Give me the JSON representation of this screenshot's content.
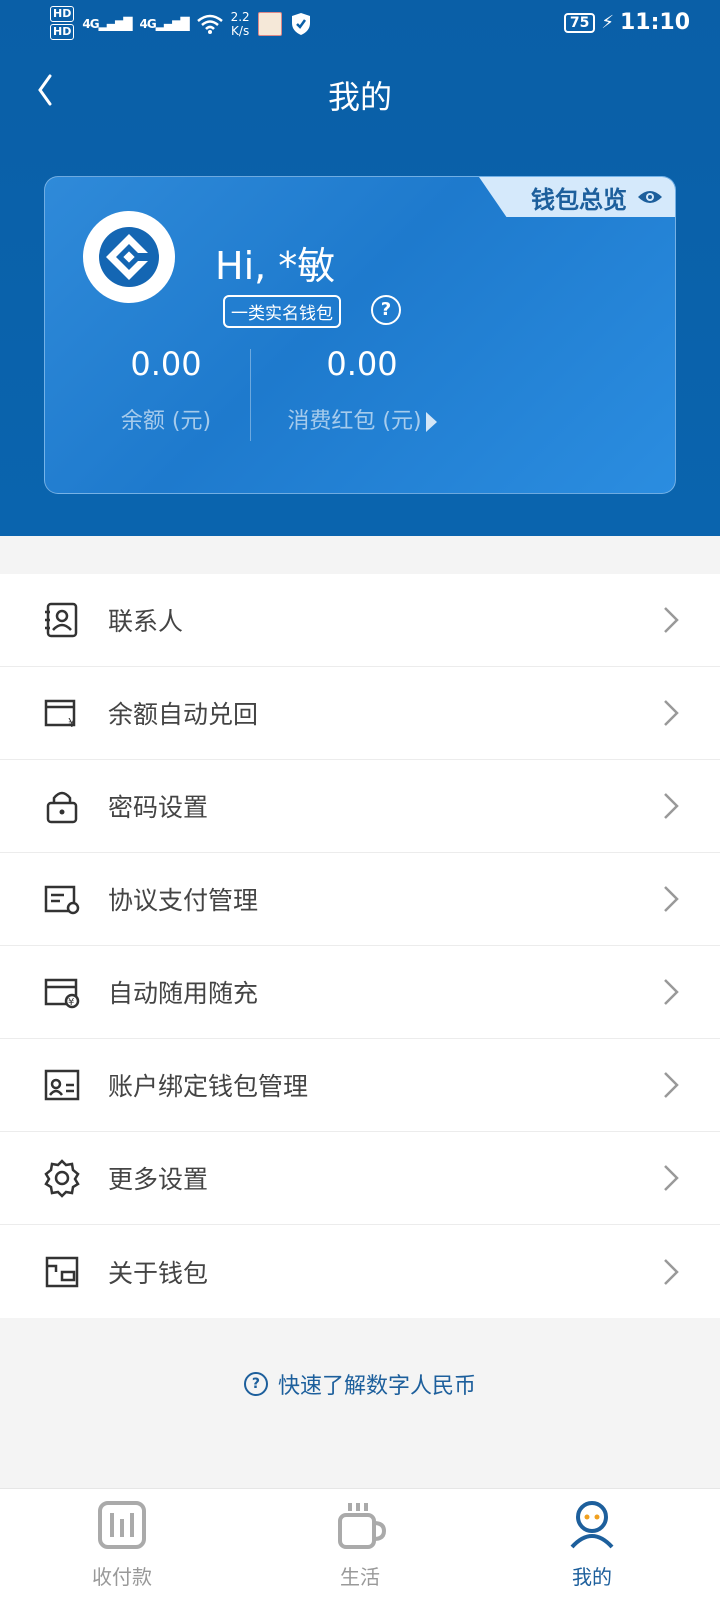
{
  "status_bar": {
    "hd1": "HD",
    "hd2": "HD",
    "sig1": "4G",
    "sig2": "4G",
    "speed": "2.2",
    "speed_unit": "K/s",
    "battery": "75",
    "time": "11:10"
  },
  "nav": {
    "title": "我的"
  },
  "card": {
    "overview_label": "钱包总览",
    "greeting": "Hi, *敏",
    "wallet_type": "一类实名钱包",
    "balance": {
      "amount": "0.00",
      "label": "余额 (元)"
    },
    "red_packet": {
      "amount": "0.00",
      "label": "消费红包 (元)"
    }
  },
  "menu": {
    "items": [
      {
        "label": "联系人",
        "icon": "contacts-icon"
      },
      {
        "label": "余额自动兑回",
        "icon": "auto-redeem-icon"
      },
      {
        "label": "密码设置",
        "icon": "lock-icon"
      },
      {
        "label": "协议支付管理",
        "icon": "agreement-pay-icon"
      },
      {
        "label": "自动随用随充",
        "icon": "auto-topup-icon"
      },
      {
        "label": "账户绑定钱包管理",
        "icon": "account-bind-icon"
      },
      {
        "label": "更多设置",
        "icon": "gear-icon"
      },
      {
        "label": "关于钱包",
        "icon": "wallet-info-icon"
      }
    ]
  },
  "quick_link": "快速了解数字人民币",
  "tabbar": {
    "tabs": [
      {
        "label": "收付款",
        "icon": "pay-receive-icon",
        "active": false
      },
      {
        "label": "生活",
        "icon": "life-cup-icon",
        "active": false
      },
      {
        "label": "我的",
        "icon": "profile-icon",
        "active": true
      }
    ]
  },
  "colors": {
    "primary": "#0a5fa7",
    "card": "#2a86d6",
    "accent_text": "#1d5f9c"
  }
}
